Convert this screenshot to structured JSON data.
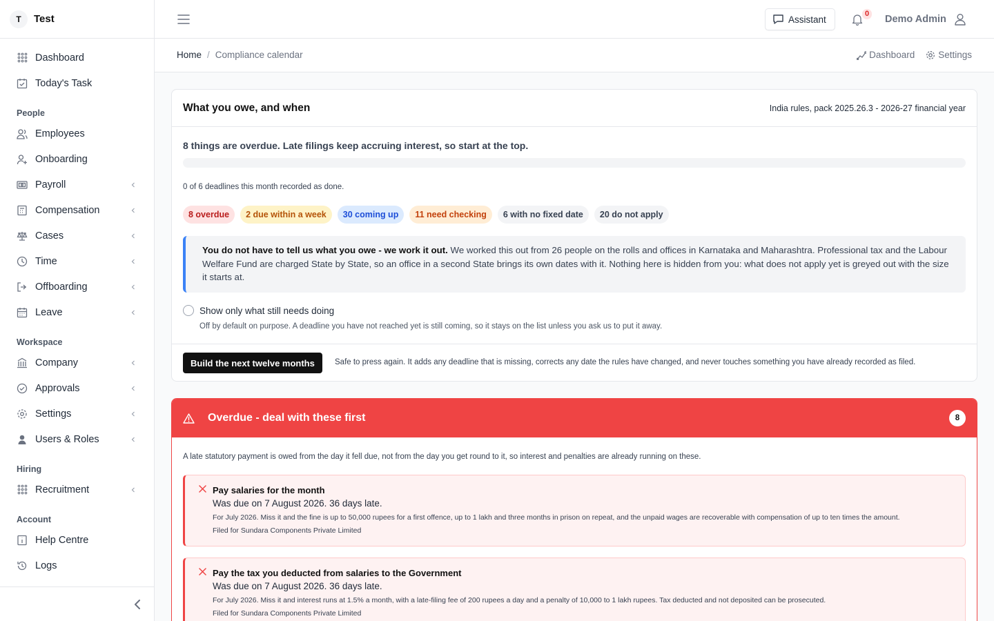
{
  "app": {
    "badge": "T",
    "name": "Test"
  },
  "sidebar": {
    "top_items": [
      {
        "label": "Dashboard",
        "icon": "grid-icon"
      },
      {
        "label": "Today's Task",
        "icon": "calendar-check-icon"
      }
    ],
    "sections": [
      {
        "title": "People",
        "items": [
          {
            "label": "Employees",
            "icon": "users-icon",
            "expandable": false
          },
          {
            "label": "Onboarding",
            "icon": "user-plus-icon",
            "expandable": false
          },
          {
            "label": "Payroll",
            "icon": "payroll-icon",
            "expandable": true
          },
          {
            "label": "Compensation",
            "icon": "calculator-icon",
            "expandable": true
          },
          {
            "label": "Cases",
            "icon": "scale-icon",
            "expandable": true
          },
          {
            "label": "Time",
            "icon": "clock-icon",
            "expandable": true
          },
          {
            "label": "Offboarding",
            "icon": "logout-icon",
            "expandable": true
          },
          {
            "label": "Leave",
            "icon": "calendar-icon",
            "expandable": true
          }
        ]
      },
      {
        "title": "Workspace",
        "items": [
          {
            "label": "Company",
            "icon": "building-icon",
            "expandable": true
          },
          {
            "label": "Approvals",
            "icon": "check-circle-icon",
            "expandable": true
          },
          {
            "label": "Settings",
            "icon": "gear-icon",
            "expandable": true
          },
          {
            "label": "Users & Roles",
            "icon": "user-shield-icon",
            "expandable": true
          }
        ]
      },
      {
        "title": "Hiring",
        "items": [
          {
            "label": "Recruitment",
            "icon": "grid-icon",
            "expandable": true
          }
        ]
      },
      {
        "title": "Account",
        "items": [
          {
            "label": "Help Centre",
            "icon": "info-icon",
            "expandable": false
          },
          {
            "label": "Logs",
            "icon": "history-icon",
            "expandable": false
          }
        ]
      }
    ]
  },
  "topbar": {
    "assistant_label": "Assistant",
    "notifications_count": "0",
    "user_name": "Demo Admin"
  },
  "breadcrumb": {
    "home": "Home",
    "separator": "/",
    "current": "Compliance calendar"
  },
  "subnav": {
    "dashboard": "Dashboard",
    "settings": "Settings"
  },
  "summary": {
    "title": "What you owe, and when",
    "meta": "India rules, pack 2025.26.3 - 2026-27 financial year",
    "lead": "8 things are overdue. Late filings keep accruing interest, so start at the top.",
    "progress_fraction": 0,
    "done_note": "0 of 6 deadlines this month recorded as done.",
    "chips": [
      {
        "label": "8 overdue",
        "tone": "red"
      },
      {
        "label": "2 due within a week",
        "tone": "amber"
      },
      {
        "label": "30 coming up",
        "tone": "blue"
      },
      {
        "label": "11 need checking",
        "tone": "orange"
      },
      {
        "label": "6 with no fixed date",
        "tone": "gray"
      },
      {
        "label": "20 do not apply",
        "tone": "gray"
      }
    ],
    "info_bold": "You do not have to tell us what you owe - we work it out.",
    "info_text": " We worked this out from 26 people on the rolls and offices in Karnataka and Maharashtra. Professional tax and the Labour Welfare Fund are charged State by State, so an office in a second State brings its own dates with it. Nothing here is hidden from you: what does not apply yet is greyed out with the size it starts at.",
    "toggle_label": "Show only what still needs doing",
    "toggle_note": "Off by default on purpose. A deadline you have not reached yet is still coming, so it stays on the list unless you ask us to put it away.",
    "build_button": "Build the next twelve months",
    "build_note": "Safe to press again. It adds any deadline that is missing, corrects any date the rules have changed, and never touches something you have already recorded as filed."
  },
  "overdue": {
    "title": "Overdue - deal with these first",
    "count": "8",
    "intro": "A late statutory payment is owed from the day it fell due, not from the day you get round to it, so interest and penalties are already running on these.",
    "items": [
      {
        "title": "Pay salaries for the month",
        "due": "Was due on 7 August 2026. 36 days late.",
        "penalty": "For July 2026. Miss it and the fine is up to 50,000 rupees for a first offence, up to 1 lakh and three months in prison on repeat, and the unpaid wages are recoverable with compensation of up to ten times the amount.",
        "filed_for": "Filed for Sundara Components Private Limited"
      },
      {
        "title": "Pay the tax you deducted from salaries to the Government",
        "due": "Was due on 7 August 2026. 36 days late.",
        "penalty": "For July 2026. Miss it and interest runs at 1.5% a month, with a late-filing fee of 200 rupees a day and a penalty of 10,000 to 1 lakh rupees. Tax deducted and not deposited can be prosecuted.",
        "filed_for": "Filed for Sundara Components Private Limited"
      }
    ]
  },
  "colors": {
    "accent_red": "#ef4444",
    "info_blue": "#3b82f6",
    "primary_button": "#111111"
  }
}
